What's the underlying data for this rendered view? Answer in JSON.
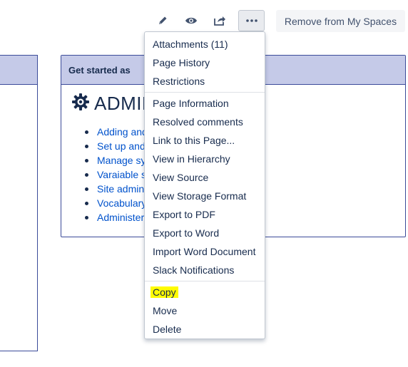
{
  "toolbar": {
    "edit_icon": "pencil-icon",
    "watch_icon": "eye-icon",
    "share_icon": "share-icon",
    "more_icon": "ellipsis-icon",
    "remove_label": "Remove from My Spaces"
  },
  "panel": {
    "header": "Get started as",
    "gear_icon": "gear-icon",
    "title": "ADMIN",
    "links": [
      "Adding and",
      "Set up and",
      "Manage sy",
      "Varaiable s",
      "Site admin",
      "Vocabulary",
      "Administer"
    ]
  },
  "menu": {
    "group1": [
      "Attachments (11)",
      "Page History",
      "Restrictions"
    ],
    "group2": [
      "Page Information",
      "Resolved comments",
      "Link to this Page...",
      "View in Hierarchy",
      "View Source",
      "View Storage Format",
      "Export to PDF",
      "Export to Word",
      "Import Word Document",
      "Slack Notifications"
    ],
    "group3": [
      "Copy",
      "Move",
      "Delete"
    ],
    "highlighted": "Copy",
    "highlight_color": "#fffb00"
  },
  "colors": {
    "panel_header_bg": "#c5cae8",
    "panel_border": "#3b4b99",
    "link": "#0052cc"
  }
}
